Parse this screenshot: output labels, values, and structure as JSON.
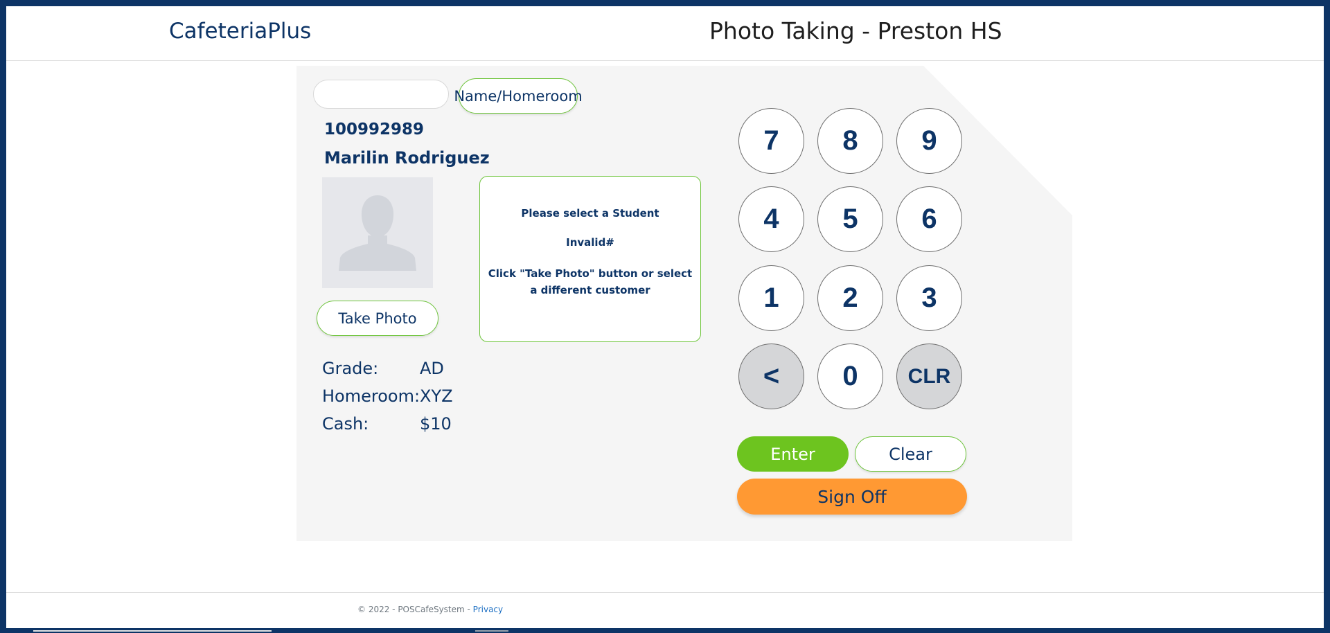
{
  "header": {
    "brand": "CafeteriaPlus",
    "title": "Photo Taking - Preston HS"
  },
  "search": {
    "value": "",
    "placeholder": "",
    "name_homeroom_label": "Name/Homeroom"
  },
  "student": {
    "id": "100992989",
    "name": "Marilin Rodriguez",
    "take_photo_label": "Take Photo",
    "fields": [
      {
        "label": "Grade:",
        "value": "AD"
      },
      {
        "label": "Homeroom:",
        "value": "XYZ"
      },
      {
        "label": "Cash:",
        "value": "$10"
      }
    ]
  },
  "messages": {
    "line1": "Please select a Student",
    "line2": "Invalid#",
    "line3": "Click \"Take Photo\" button or select a different customer"
  },
  "keypad": {
    "keys": [
      "7",
      "8",
      "9",
      "4",
      "5",
      "6",
      "1",
      "2",
      "3",
      "<",
      "0",
      "CLR"
    ]
  },
  "actions": {
    "enter_label": "Enter",
    "clear_label": "Clear",
    "signoff_label": "Sign Off"
  },
  "footer": {
    "copyright": "© 2022 - POSCafeSystem - ",
    "privacy_label": "Privacy"
  },
  "colors": {
    "brand_navy": "#0d3466",
    "accent_green": "#6dc43a",
    "signoff_orange": "#ff9933"
  }
}
